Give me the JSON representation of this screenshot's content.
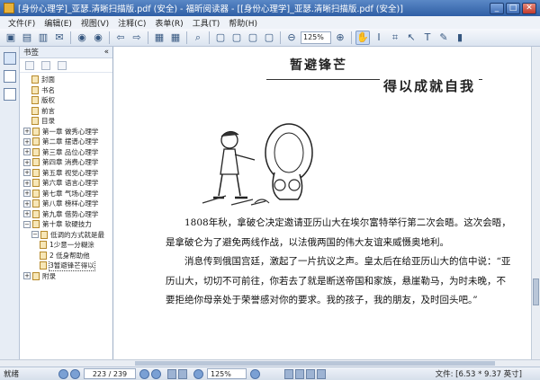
{
  "window": {
    "title": "[身份心理学]_亚瑟.清晰扫描版.pdf (安全) - 福昕阅读器 - [[身份心理学]_亚瑟.清晰扫描版.pdf (安全)]",
    "minimize": "_",
    "maximize": "□",
    "close": "✕"
  },
  "menu": [
    "文件(F)",
    "编辑(E)",
    "视图(V)",
    "注释(C)",
    "表单(R)",
    "工具(T)",
    "帮助(H)"
  ],
  "toolbar": {
    "zoom_value": "125%"
  },
  "bookmark_panel": {
    "title": "书签",
    "collapse": "«",
    "items": [
      {
        "label": "封面",
        "level": 1,
        "type": "page"
      },
      {
        "label": "书名",
        "level": 1,
        "type": "page"
      },
      {
        "label": "版权",
        "level": 1,
        "type": "page"
      },
      {
        "label": "前言",
        "level": 1,
        "type": "page"
      },
      {
        "label": "目录",
        "level": 1,
        "type": "page"
      },
      {
        "label": "第一章  做秀心理学",
        "level": 0,
        "type": "expand",
        "sign": "+"
      },
      {
        "label": "第二章  摆谱心理学",
        "level": 0,
        "type": "expand",
        "sign": "+"
      },
      {
        "label": "第三章  品位心理学",
        "level": 0,
        "type": "expand",
        "sign": "+"
      },
      {
        "label": "第四章  消费心理学",
        "level": 0,
        "type": "expand",
        "sign": "+"
      },
      {
        "label": "第五章  视觉心理学",
        "level": 0,
        "type": "expand",
        "sign": "+"
      },
      {
        "label": "第六章  语言心理学",
        "level": 0,
        "type": "expand",
        "sign": "+"
      },
      {
        "label": "第七章  气场心理学",
        "level": 0,
        "type": "expand",
        "sign": "+"
      },
      {
        "label": "第八章  榜样心理学",
        "level": 0,
        "type": "expand",
        "sign": "+"
      },
      {
        "label": "第九章  借势心理学",
        "level": 0,
        "type": "expand",
        "sign": "+"
      },
      {
        "label": "第十章  软硬技力",
        "level": 0,
        "type": "expand",
        "sign": "−"
      },
      {
        "label": "低调的方式就是最",
        "level": 1,
        "type": "expand",
        "sign": "−"
      },
      {
        "label": "1少意一分糊涂",
        "level": 2,
        "type": "page"
      },
      {
        "label": "2  低身帮助他",
        "level": 2,
        "type": "page"
      },
      {
        "label": "3暂避锋芒得以",
        "level": 2,
        "type": "page",
        "selected": true
      },
      {
        "label": "附录",
        "level": 0,
        "type": "expand",
        "sign": "+"
      }
    ]
  },
  "page": {
    "heading_1": "暂避锋芒",
    "heading_2": "得以成就自我",
    "paragraphs": [
      "1808年秋，拿破仑决定邀请亚历山大在埃尔富特举行第二次会晤。这次会晤，是拿破仑为了避免两线作战，以法俄两国的伟大友谊来威慑奥地利。",
      "消息传到俄国宫廷，激起了一片抗议之声。皇太后在给亚历山大的信中说：“亚历山大，切切不可前往，你若去了就是断送帝国和家族，悬崖勒马，为时未晚，不要拒绝你母亲处于荣誉感对你的要求。我的孩子，我的朋友，及时回头吧。”"
    ]
  },
  "status": {
    "left": "就绪",
    "page_indicator": "223 / 239",
    "zoom": "125%",
    "doc_size": "文件: [6.53 * 9.37 英寸]"
  }
}
